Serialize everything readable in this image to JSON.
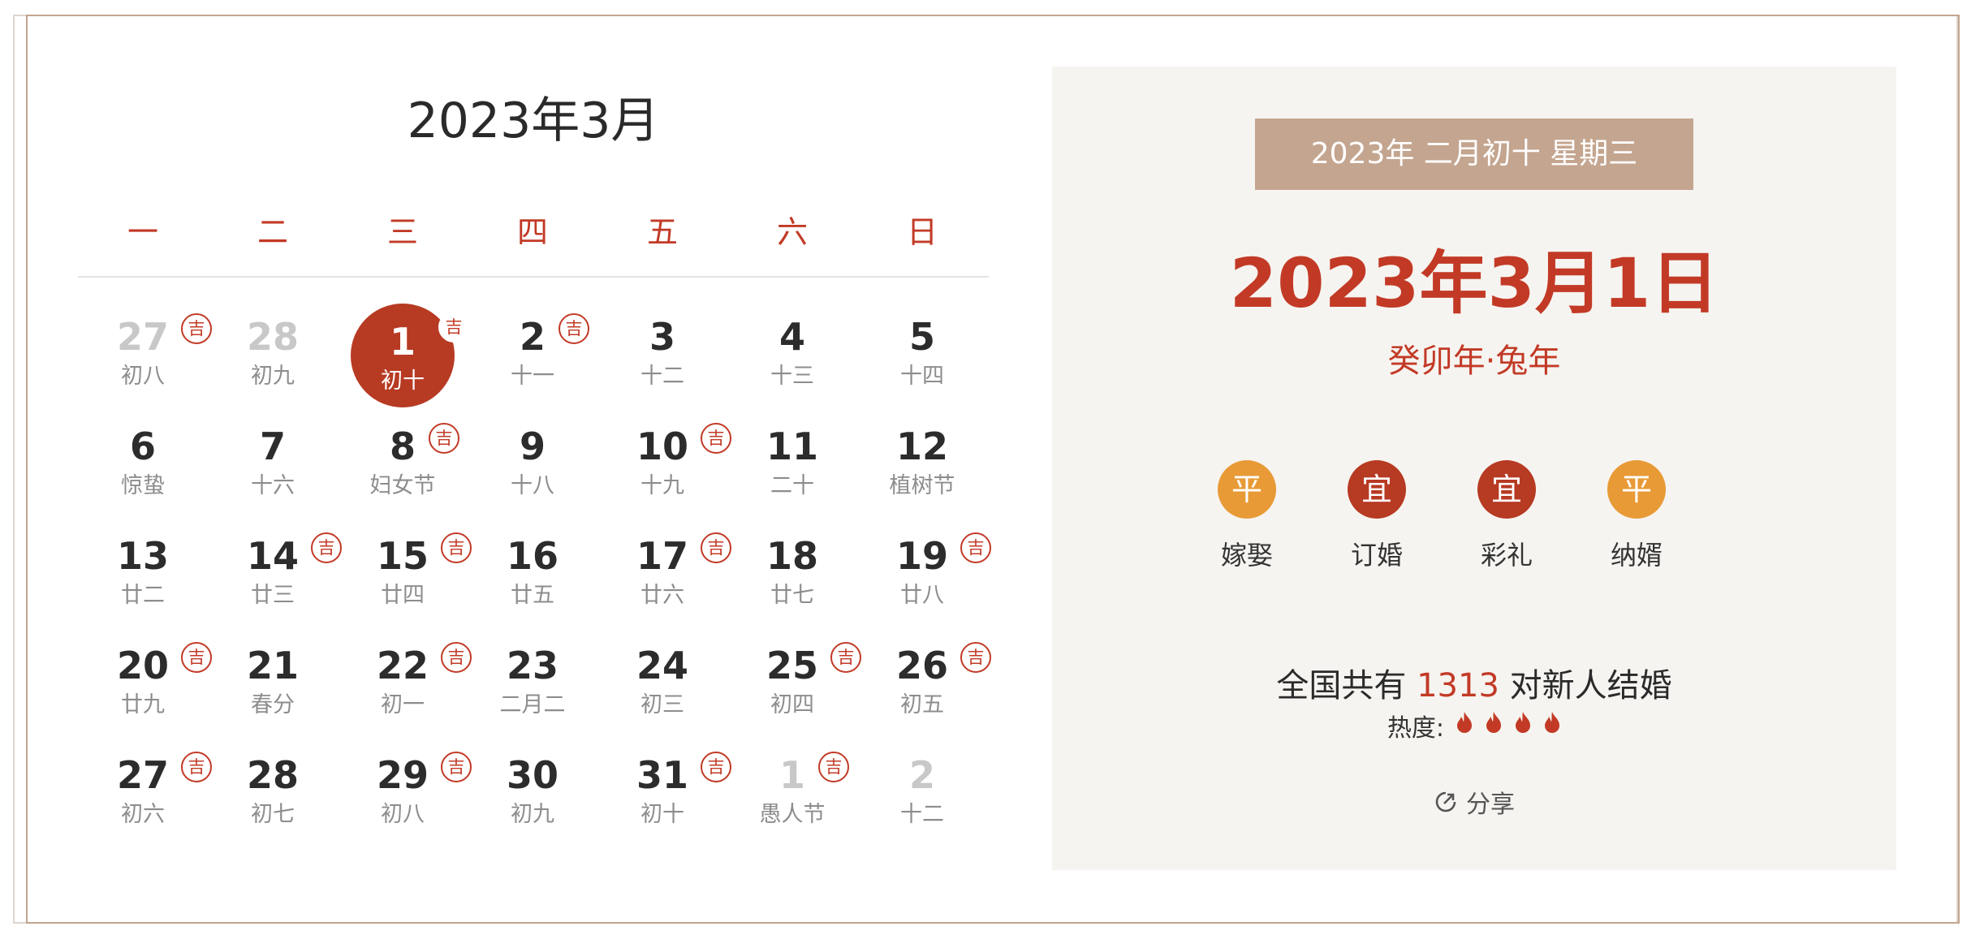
{
  "calendar": {
    "title": "2023年3月",
    "weekdays": [
      "一",
      "二",
      "三",
      "四",
      "五",
      "六",
      "日"
    ],
    "ji_label": "吉",
    "weeks": [
      [
        {
          "day": "27",
          "lunar": "初八",
          "muted": true,
          "ji": true
        },
        {
          "day": "28",
          "lunar": "初九",
          "muted": true,
          "ji": false
        },
        {
          "day": "1",
          "lunar": "初十",
          "selected": true,
          "ji": true
        },
        {
          "day": "2",
          "lunar": "十一",
          "ji": true
        },
        {
          "day": "3",
          "lunar": "十二",
          "ji": false
        },
        {
          "day": "4",
          "lunar": "十三",
          "ji": false
        },
        {
          "day": "5",
          "lunar": "十四",
          "ji": false
        }
      ],
      [
        {
          "day": "6",
          "lunar": "惊蛰",
          "ji": false
        },
        {
          "day": "7",
          "lunar": "十六",
          "ji": false
        },
        {
          "day": "8",
          "lunar": "妇女节",
          "ji": true
        },
        {
          "day": "9",
          "lunar": "十八",
          "ji": false
        },
        {
          "day": "10",
          "lunar": "十九",
          "ji": true
        },
        {
          "day": "11",
          "lunar": "二十",
          "ji": false
        },
        {
          "day": "12",
          "lunar": "植树节",
          "ji": false
        }
      ],
      [
        {
          "day": "13",
          "lunar": "廿二",
          "ji": false
        },
        {
          "day": "14",
          "lunar": "廿三",
          "ji": true
        },
        {
          "day": "15",
          "lunar": "廿四",
          "ji": true
        },
        {
          "day": "16",
          "lunar": "廿五",
          "ji": false
        },
        {
          "day": "17",
          "lunar": "廿六",
          "ji": true
        },
        {
          "day": "18",
          "lunar": "廿七",
          "ji": false
        },
        {
          "day": "19",
          "lunar": "廿八",
          "ji": true
        }
      ],
      [
        {
          "day": "20",
          "lunar": "廿九",
          "ji": true
        },
        {
          "day": "21",
          "lunar": "春分",
          "ji": false
        },
        {
          "day": "22",
          "lunar": "初一",
          "ji": true
        },
        {
          "day": "23",
          "lunar": "二月二",
          "ji": false
        },
        {
          "day": "24",
          "lunar": "初三",
          "ji": false
        },
        {
          "day": "25",
          "lunar": "初四",
          "ji": true
        },
        {
          "day": "26",
          "lunar": "初五",
          "ji": true
        }
      ],
      [
        {
          "day": "27",
          "lunar": "初六",
          "ji": true
        },
        {
          "day": "28",
          "lunar": "初七",
          "ji": false
        },
        {
          "day": "29",
          "lunar": "初八",
          "ji": true
        },
        {
          "day": "30",
          "lunar": "初九",
          "ji": false
        },
        {
          "day": "31",
          "lunar": "初十",
          "ji": true
        },
        {
          "day": "1",
          "lunar": "愚人节",
          "muted": true,
          "ji": true
        },
        {
          "day": "2",
          "lunar": "十二",
          "muted": true,
          "ji": false
        }
      ]
    ]
  },
  "panel": {
    "lunar_info": "2023年  二月初十   星期三",
    "date": "2023年3月1日",
    "zodiac": "癸卯年·兔年",
    "activities": [
      {
        "badge": "平",
        "label": "嫁娶",
        "type": "ping"
      },
      {
        "badge": "宜",
        "label": "订婚",
        "type": "yi"
      },
      {
        "badge": "宜",
        "label": "彩礼",
        "type": "yi"
      },
      {
        "badge": "平",
        "label": "纳婿",
        "type": "ping"
      }
    ],
    "stats_prefix": "全国共有 ",
    "couple_count": "1313",
    "stats_suffix": " 对新人结婚",
    "heat_label": "热度:",
    "heat_level": 4,
    "share_label": "分享"
  },
  "colors": {
    "accent_red": "#c23a26",
    "selected_red": "#b73a23",
    "ping_orange": "#e89a36",
    "pill_tan": "#c4a58f",
    "panel_bg": "#f6f4f0"
  },
  "icons": {
    "flame": "flame-icon",
    "share": "share-icon"
  }
}
